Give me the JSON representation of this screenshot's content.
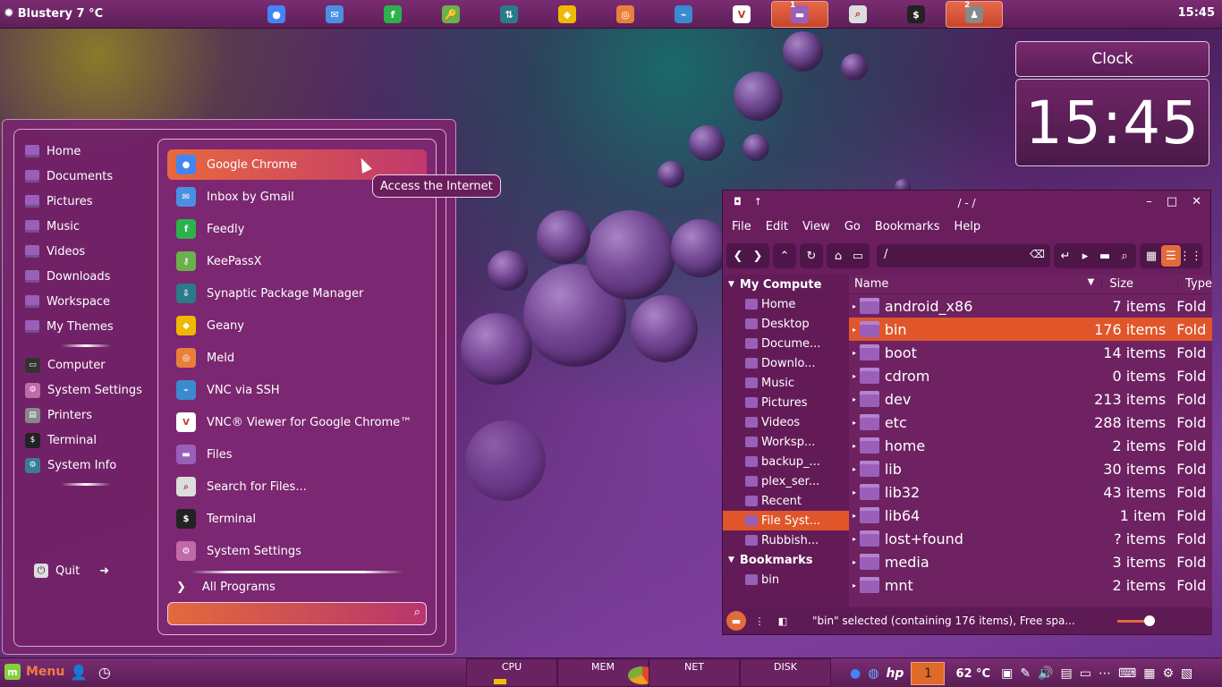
{
  "top_panel": {
    "weather": "Blustery 7 °C",
    "time": "15:45",
    "launchers": [
      {
        "name": "chrome-icon",
        "color": "#4285f4",
        "glyph": "●",
        "badge": ""
      },
      {
        "name": "gmail-inbox-icon",
        "color": "#4a90e2",
        "glyph": "✉",
        "badge": ""
      },
      {
        "name": "feedly-icon",
        "color": "#2bb24c",
        "glyph": "f",
        "badge": ""
      },
      {
        "name": "keepassx-icon",
        "color": "#6ab04c",
        "glyph": "🔑",
        "badge": ""
      },
      {
        "name": "synaptic-icon",
        "color": "#2a7a8a",
        "glyph": "⇅",
        "badge": ""
      },
      {
        "name": "geany-icon",
        "color": "#f0b800",
        "glyph": "◆",
        "badge": ""
      },
      {
        "name": "meld-icon",
        "color": "#e8803a",
        "glyph": "◎",
        "badge": ""
      },
      {
        "name": "vnc-ssh-icon",
        "color": "#3a8ad0",
        "glyph": "⌁",
        "badge": ""
      },
      {
        "name": "vnc-viewer-icon",
        "color": "#ffffff",
        "glyph": "V",
        "badge": ""
      },
      {
        "name": "files-icon",
        "color": "#9a5fb8",
        "glyph": "▬",
        "badge": "1"
      },
      {
        "name": "search-files-icon",
        "color": "#dddddd",
        "glyph": "⌕",
        "badge": ""
      },
      {
        "name": "terminal-icon",
        "color": "#222222",
        "glyph": "$",
        "badge": ""
      },
      {
        "name": "user-icon",
        "color": "#888888",
        "glyph": "♟",
        "badge": "2"
      }
    ]
  },
  "clock": {
    "title": "Clock",
    "time": "15:45"
  },
  "menu": {
    "places": [
      "Home",
      "Documents",
      "Pictures",
      "Music",
      "Videos",
      "Downloads",
      "Workspace",
      "My Themes"
    ],
    "system": [
      {
        "label": "Computer",
        "color": "#333333",
        "glyph": "▭"
      },
      {
        "label": "System Settings",
        "color": "#c06aa8",
        "glyph": "⚙"
      },
      {
        "label": "Printers",
        "color": "#888888",
        "glyph": "▤"
      },
      {
        "label": "Terminal",
        "color": "#222222",
        "glyph": "$"
      },
      {
        "label": "System Info",
        "color": "#3a7a9a",
        "glyph": "⚙"
      }
    ],
    "quit": "Quit",
    "apps": [
      {
        "label": "Google Chrome",
        "color": "#4285f4",
        "glyph": "●",
        "icon": "chrome-icon"
      },
      {
        "label": "Inbox by Gmail",
        "color": "#4a90e2",
        "glyph": "✉",
        "icon": "gmail-inbox-icon"
      },
      {
        "label": "Feedly",
        "color": "#2bb24c",
        "glyph": "f",
        "icon": "feedly-icon"
      },
      {
        "label": "KeePassX",
        "color": "#6ab04c",
        "glyph": "⚷",
        "icon": "keepassx-icon"
      },
      {
        "label": "Synaptic Package Manager",
        "color": "#2a7a8a",
        "glyph": "⇩",
        "icon": "synaptic-icon"
      },
      {
        "label": "Geany",
        "color": "#f0b800",
        "glyph": "◆",
        "icon": "geany-icon"
      },
      {
        "label": "Meld",
        "color": "#e8803a",
        "glyph": "◎",
        "icon": "meld-icon"
      },
      {
        "label": "VNC via SSH",
        "color": "#3a8ad0",
        "glyph": "⌁",
        "icon": "vnc-ssh-icon"
      },
      {
        "label": "VNC® Viewer for Google Chrome™",
        "color": "#ffffff",
        "glyph": "V",
        "icon": "vnc-viewer-icon"
      },
      {
        "label": "Files",
        "color": "#9a5fb8",
        "glyph": "▬",
        "icon": "folder-icon"
      },
      {
        "label": "Search for Files...",
        "color": "#dddddd",
        "glyph": "⌕",
        "icon": "search-files-icon"
      },
      {
        "label": "Terminal",
        "color": "#222222",
        "glyph": "$",
        "icon": "terminal-icon"
      },
      {
        "label": "System Settings",
        "color": "#c06aa8",
        "glyph": "⚙",
        "icon": "settings-icon"
      }
    ],
    "all_programs": "All Programs",
    "tooltip": "Access the Internet"
  },
  "file_manager": {
    "title": "/ - /",
    "menubar": [
      "File",
      "Edit",
      "View",
      "Go",
      "Bookmarks",
      "Help"
    ],
    "path": "/",
    "sidebar_head": "My Compute",
    "sidebar_items": [
      "Home",
      "Desktop",
      "Docume...",
      "Downlo...",
      "Music",
      "Pictures",
      "Videos",
      "Worksp...",
      "backup_...",
      "plex_ser...",
      "Recent",
      "File Syst...",
      "Rubbish..."
    ],
    "bookmarks_head": "Bookmarks",
    "bookmark_items": [
      "bin"
    ],
    "columns": {
      "name": "Name",
      "size": "Size",
      "type": "Type"
    },
    "rows": [
      {
        "name": "android_x86",
        "size": "7 items",
        "type": "Fold"
      },
      {
        "name": "bin",
        "size": "176 items",
        "type": "Fold"
      },
      {
        "name": "boot",
        "size": "14 items",
        "type": "Fold"
      },
      {
        "name": "cdrom",
        "size": "0 items",
        "type": "Fold"
      },
      {
        "name": "dev",
        "size": "213 items",
        "type": "Fold"
      },
      {
        "name": "etc",
        "size": "288 items",
        "type": "Fold"
      },
      {
        "name": "home",
        "size": "2 items",
        "type": "Fold"
      },
      {
        "name": "lib",
        "size": "30 items",
        "type": "Fold"
      },
      {
        "name": "lib32",
        "size": "43 items",
        "type": "Fold"
      },
      {
        "name": "lib64",
        "size": "1 item",
        "type": "Fold"
      },
      {
        "name": "lost+found",
        "size": "? items",
        "type": "Fold"
      },
      {
        "name": "media",
        "size": "3 items",
        "type": "Fold"
      },
      {
        "name": "mnt",
        "size": "2 items",
        "type": "Fold"
      }
    ],
    "status": "\"bin\" selected (containing 176 items), Free spa..."
  },
  "bottom_panel": {
    "menu_label": "Menu",
    "monitors": [
      "CPU",
      "MEM",
      "NET",
      "DISK"
    ],
    "workspace": "1",
    "temperature": "62 °C"
  }
}
